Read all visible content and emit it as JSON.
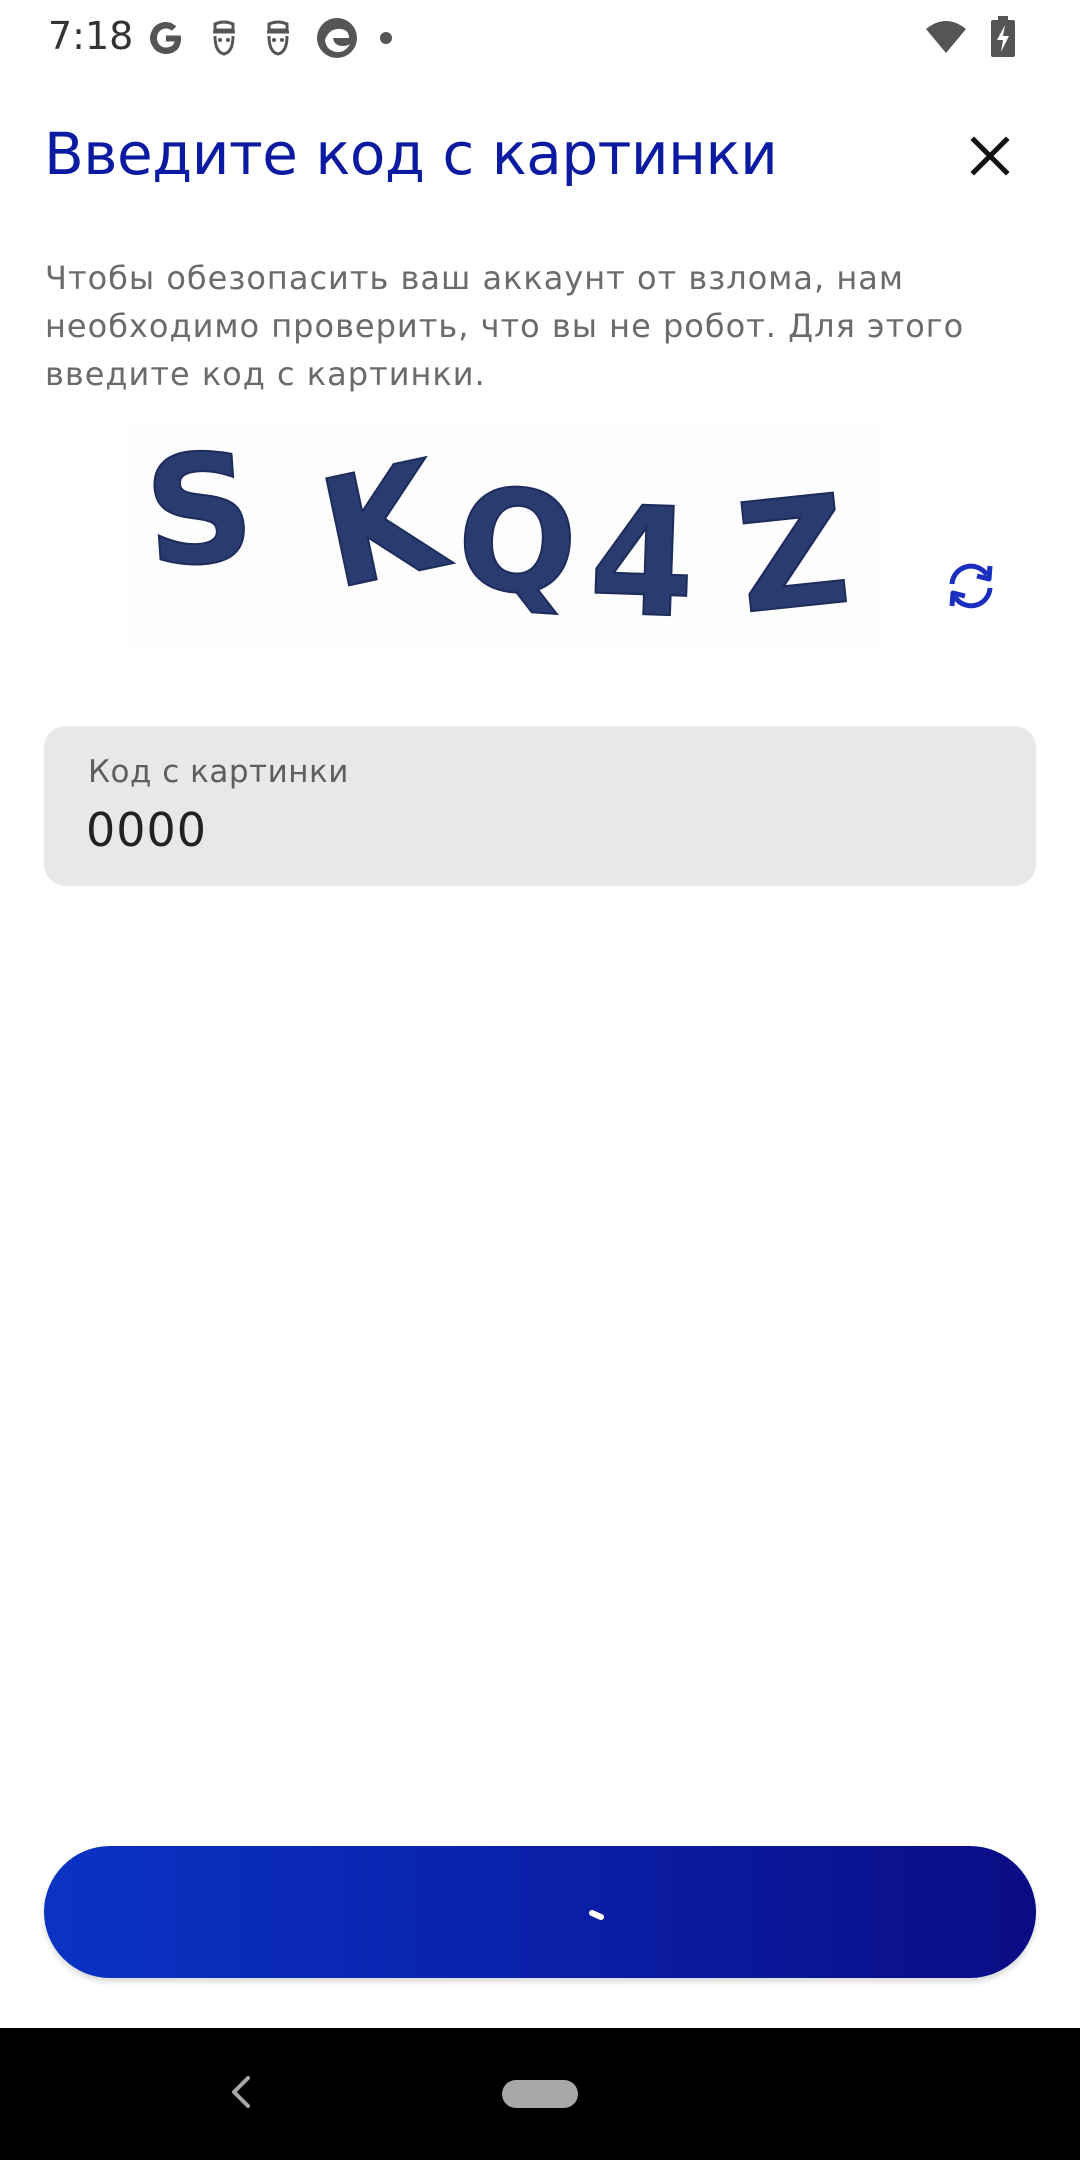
{
  "status_bar": {
    "time": "7:18",
    "left_icons": [
      "google-icon",
      "mask-icon",
      "mask-icon",
      "edge-icon",
      "dot-icon"
    ],
    "right_icons": [
      "wifi-icon",
      "battery-charging-icon"
    ]
  },
  "header": {
    "title": "Введите код с картинки",
    "close_icon": "close-icon"
  },
  "description": "Чтобы обезопасить ваш аккаунт от взлома, нам необходимо проверить, что вы не робот. Для этого введите код с картинки.",
  "captcha": {
    "text": "SKQ4Z",
    "refresh_icon": "refresh-icon",
    "accent_color": "#1a2fc0"
  },
  "code_field": {
    "label": "Код с картинки",
    "value": "0000"
  },
  "submit_button": {
    "state": "loading",
    "gradient": [
      "#0a33c4",
      "#0a0c84"
    ]
  },
  "colors": {
    "title": "#0b1ba1",
    "text_secondary": "#6b6b6b",
    "field_bg": "#e8e8e8"
  }
}
